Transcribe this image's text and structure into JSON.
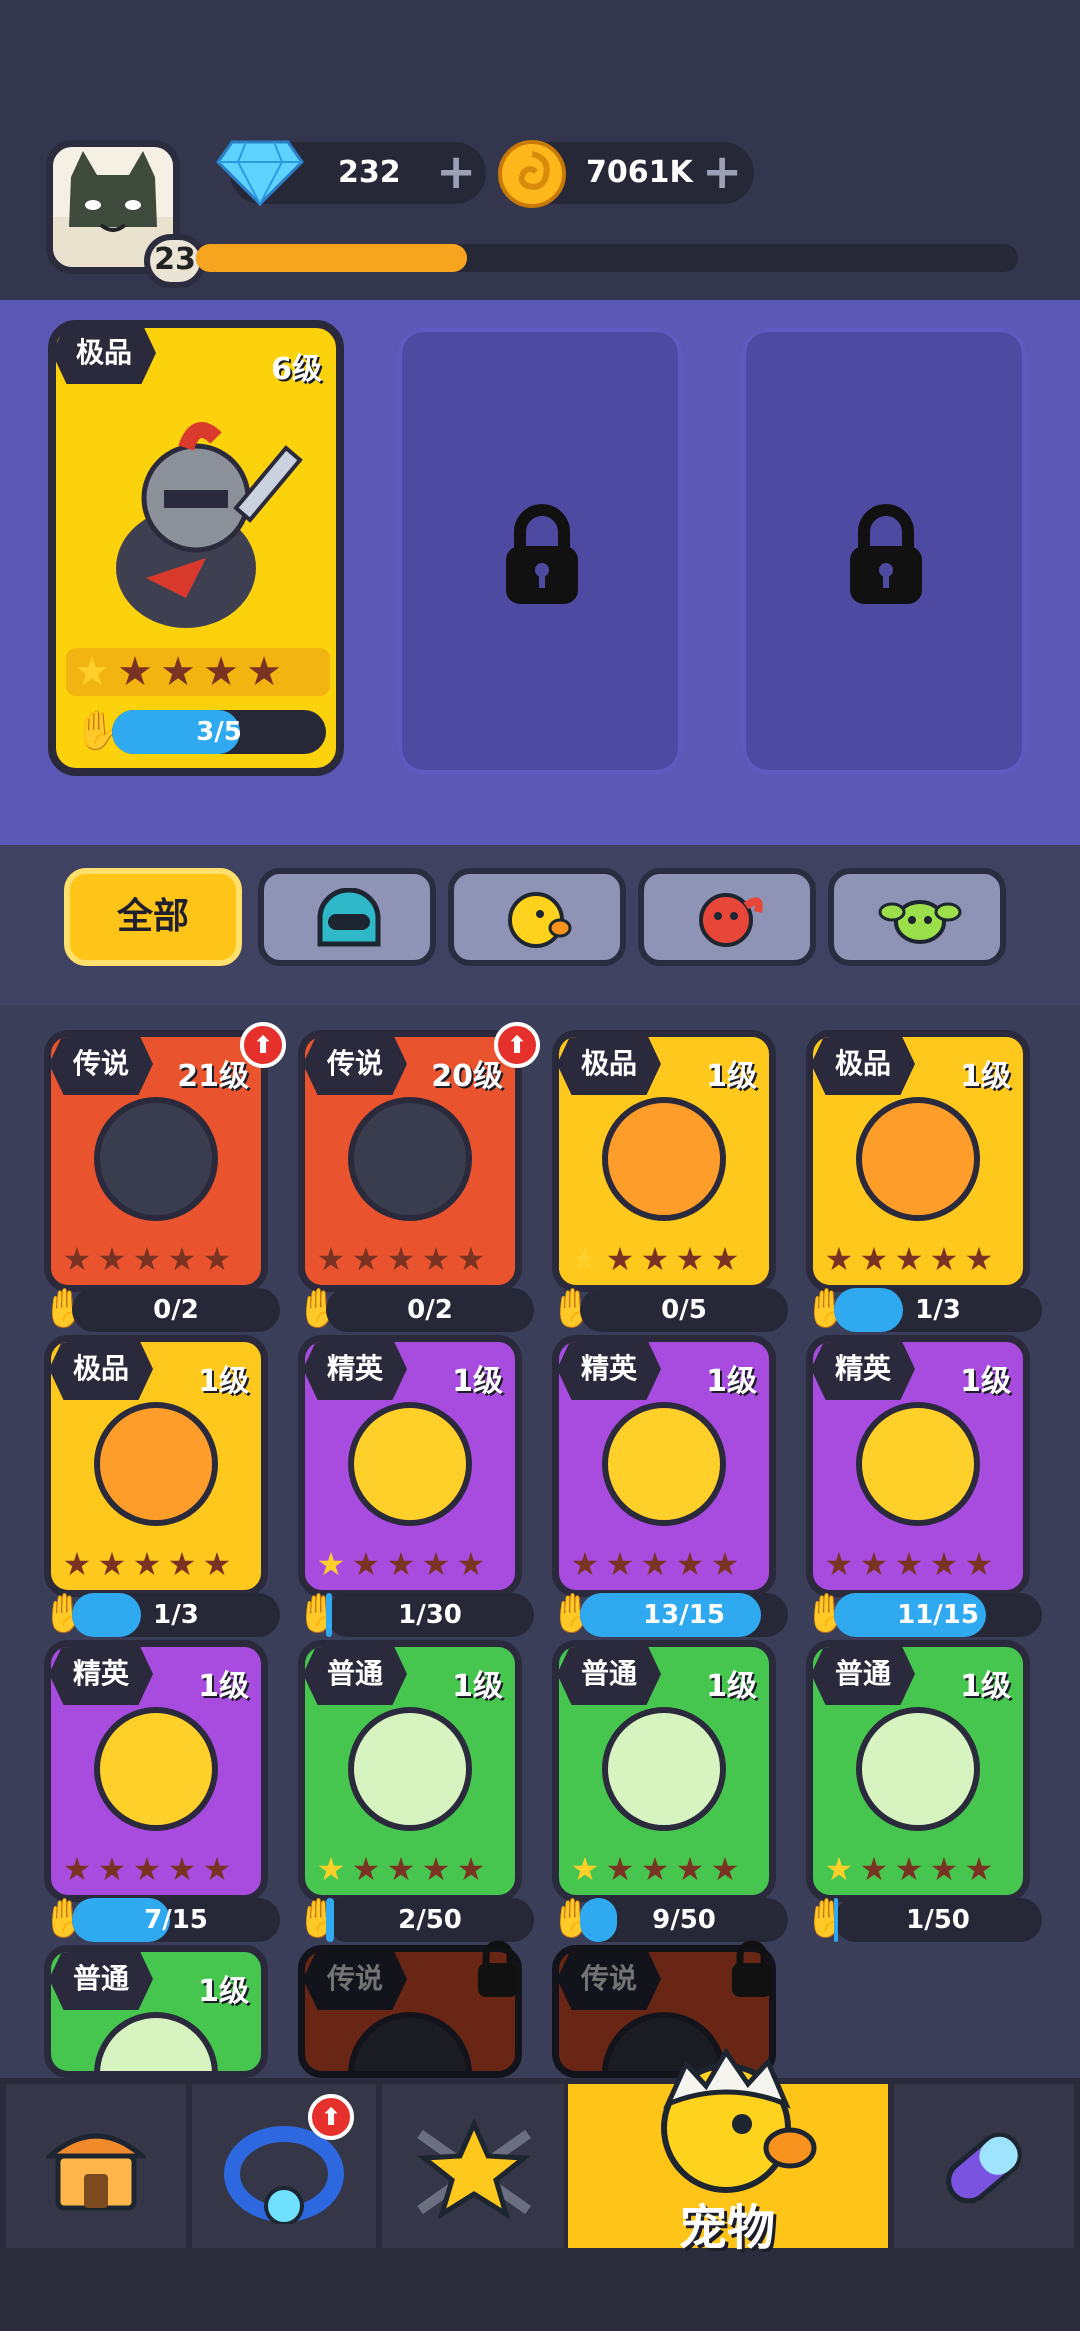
{
  "player": {
    "level": "23",
    "xp_fraction": 0.33
  },
  "currency": {
    "gems": "232",
    "coins": "7061K"
  },
  "team": {
    "slot1": {
      "rank": "极品",
      "level": "6级",
      "stars": 1,
      "progress": "3/5",
      "progress_fraction": 0.6
    },
    "slot2_locked": true,
    "slot3_locked": true
  },
  "filters": {
    "tabs": [
      {
        "label": "全部",
        "active": true
      },
      {
        "icon": "helmet-icon"
      },
      {
        "icon": "chick-icon"
      },
      {
        "icon": "red-blob-icon"
      },
      {
        "icon": "green-sprout-icon"
      }
    ]
  },
  "pets": [
    {
      "rank": "传说",
      "level": "21级",
      "stars": 0,
      "progress": "0/2",
      "fraction": 0,
      "tier": "legend",
      "upgrade": true
    },
    {
      "rank": "传说",
      "level": "20级",
      "stars": 0,
      "progress": "0/2",
      "fraction": 0,
      "tier": "legend",
      "upgrade": true
    },
    {
      "rank": "极品",
      "level": "1级",
      "stars": 1,
      "progress": "0/5",
      "fraction": 0,
      "tier": "epic"
    },
    {
      "rank": "极品",
      "level": "1级",
      "stars": 0,
      "progress": "1/3",
      "fraction": 0.33,
      "tier": "epic"
    },
    {
      "rank": "极品",
      "level": "1级",
      "stars": 0,
      "progress": "1/3",
      "fraction": 0.33,
      "tier": "epic"
    },
    {
      "rank": "精英",
      "level": "1级",
      "stars": 1,
      "progress": "1/30",
      "fraction": 0.03,
      "tier": "elite"
    },
    {
      "rank": "精英",
      "level": "1级",
      "stars": 0,
      "progress": "13/15",
      "fraction": 0.87,
      "tier": "elite"
    },
    {
      "rank": "精英",
      "level": "1级",
      "stars": 0,
      "progress": "11/15",
      "fraction": 0.73,
      "tier": "elite"
    },
    {
      "rank": "精英",
      "level": "1级",
      "stars": 0,
      "progress": "7/15",
      "fraction": 0.47,
      "tier": "elite"
    },
    {
      "rank": "普通",
      "level": "1级",
      "stars": 1,
      "progress": "2/50",
      "fraction": 0.04,
      "tier": "common"
    },
    {
      "rank": "普通",
      "level": "1级",
      "stars": 1,
      "progress": "9/50",
      "fraction": 0.18,
      "tier": "common"
    },
    {
      "rank": "普通",
      "level": "1级",
      "stars": 1,
      "progress": "1/50",
      "fraction": 0.02,
      "tier": "common"
    },
    {
      "rank": "普通",
      "level": "1级",
      "tier": "common"
    },
    {
      "rank": "传说",
      "tier": "legend",
      "locked": true
    },
    {
      "rank": "传说",
      "tier": "legend",
      "locked": true
    }
  ],
  "nav": {
    "active_label": "宠物",
    "items": [
      "shop-icon",
      "ring-icon",
      "star-swords-icon",
      "pet-chick-icon",
      "capsule-icon"
    ]
  },
  "colors": {
    "legend": "#e9542e",
    "epic": "#ffc81c",
    "elite": "#a84ce0",
    "common": "#46c64e",
    "accent": "#ffc418"
  }
}
